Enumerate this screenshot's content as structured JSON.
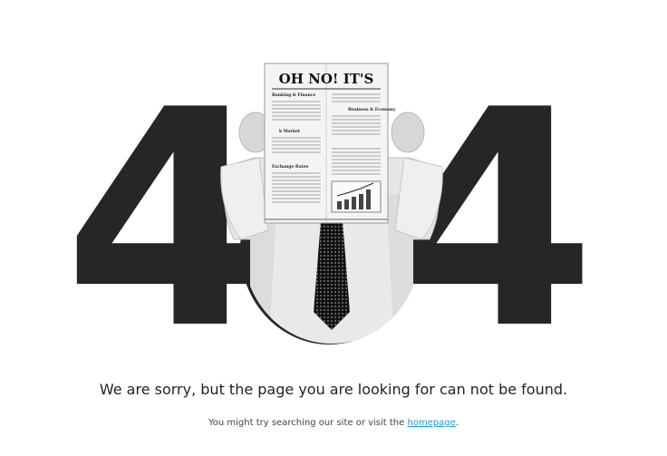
{
  "hero": {
    "digit_left": "4",
    "digit_right": "4",
    "newspaper": {
      "headline": "OH NO! IT'S",
      "sections": [
        "Banking & Finance",
        "Business & Economy",
        "k Market",
        "Exchange Rates"
      ]
    }
  },
  "message": {
    "main": "We are sorry, but the page you are looking for can not be found.",
    "sub_prefix": "You might try searching our site or visit the ",
    "sub_link": "homepage",
    "sub_suffix": "."
  },
  "colors": {
    "digit": "#262626",
    "link": "#1a9bd7",
    "text": "#222222"
  }
}
